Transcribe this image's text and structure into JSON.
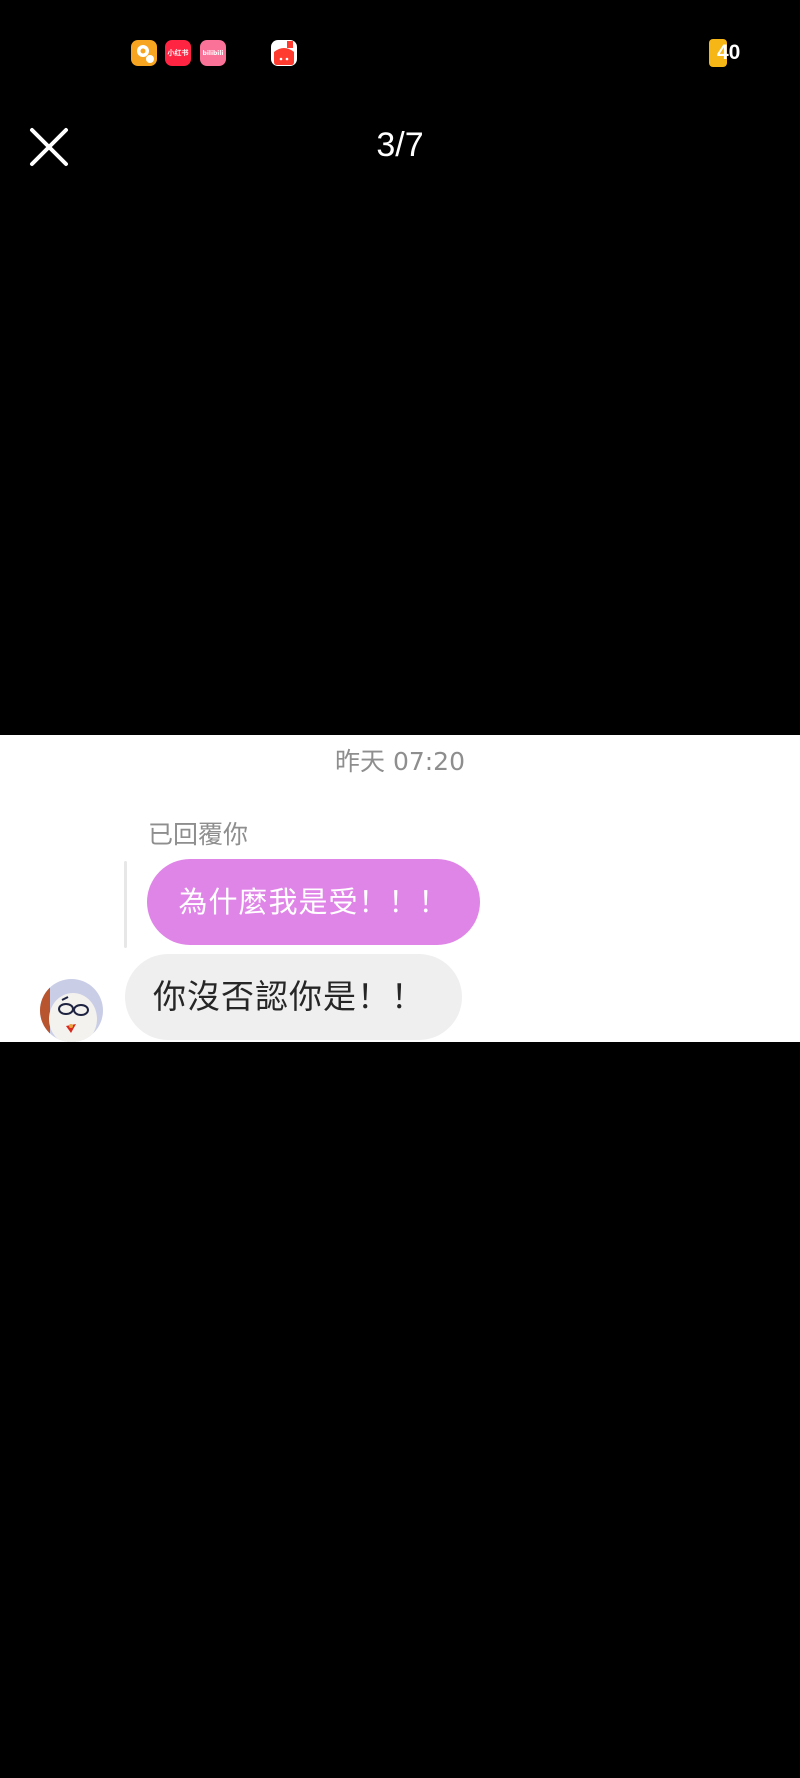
{
  "status_bar": {
    "notification_icons": [
      {
        "name": "maps-app-icon",
        "color": "#f7a521"
      },
      {
        "name": "xiaohongshu-app-icon",
        "color": "#ff2442",
        "label": "小红书"
      },
      {
        "name": "bilibili-app-icon",
        "color": "#fb7299",
        "label": "bilibili"
      },
      {
        "name": "calendar-app-icon",
        "color": "#ff3b2f"
      }
    ],
    "battery_level": "40",
    "battery_color": "#f6b616"
  },
  "viewer": {
    "page_counter": "3/7",
    "close_icon": "close-icon"
  },
  "chat": {
    "timestamp": "昨天 07:20",
    "reply_label": "已回覆你",
    "quoted_message": "為什麼我是受！！！",
    "quoted_bubble_color": "#e085e8",
    "message": "你沒否認你是！！",
    "message_bubble_color": "#efefef",
    "avatar": "avatar-cartoon-glasses"
  }
}
